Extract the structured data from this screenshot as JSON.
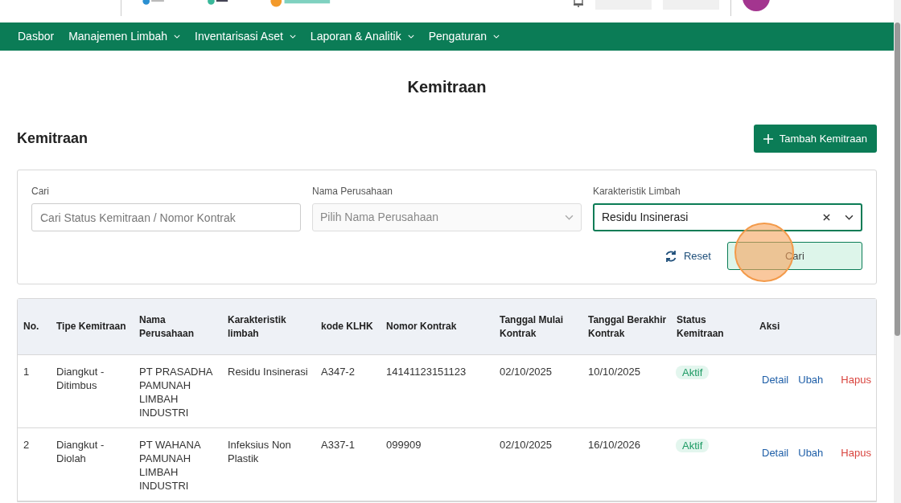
{
  "nav": [
    {
      "label": "Dasbor",
      "dropdown": false
    },
    {
      "label": "Manajemen Limbah",
      "dropdown": true
    },
    {
      "label": "Inventarisasi Aset",
      "dropdown": true
    },
    {
      "label": "Laporan & Analitik",
      "dropdown": true
    },
    {
      "label": "Pengaturan",
      "dropdown": true
    }
  ],
  "page_title": "Kemitraan",
  "section_title": "Kemitraan",
  "add_button": "Tambah Kemitraan",
  "filters": [
    {
      "kind": "text",
      "label": "Cari",
      "placeholder": "Cari Status Kemitraan / Nomor Kontrak"
    },
    {
      "kind": "select",
      "label": "Nama Perusahaan",
      "placeholder": "Pilih Nama Perusahaan"
    },
    {
      "kind": "select",
      "label": "Karakteristik Limbah",
      "value": "Residu Insinerasi"
    }
  ],
  "reset_button": "Reset",
  "search_button": "Cari",
  "table": {
    "columns": [
      "No.",
      "Tipe Kemitraan",
      "Nama Perusahaan",
      "Karakteristik limbah",
      "kode KLHK",
      "Nomor Kontrak",
      "Tanggal Mulai Kontrak",
      "Tanggal Berakhir Kontrak",
      "Status Kemitraan",
      "Aksi"
    ],
    "rows": [
      {
        "cells": [
          "1",
          "Diangkut - Ditimbus",
          "PT PRASADHA PAMUNAH LIMBAH INDUSTRI",
          "Residu Insinerasi",
          "A347-2",
          "14141123151123",
          "02/10/2025",
          "10/10/2025"
        ],
        "status": "Aktif",
        "actions": [
          "Detail",
          "Ubah",
          "Hapus"
        ]
      },
      {
        "cells": [
          "2",
          "Diangkut - Diolah",
          "PT WAHANA PAMUNAH LIMBAH INDUSTRI",
          "Infeksius Non Plastik",
          "A337-1",
          "099909",
          "02/10/2025",
          "16/10/2026"
        ],
        "status": "Aktif",
        "actions": [
          "Detail",
          "Ubah",
          "Hapus"
        ]
      }
    ]
  }
}
